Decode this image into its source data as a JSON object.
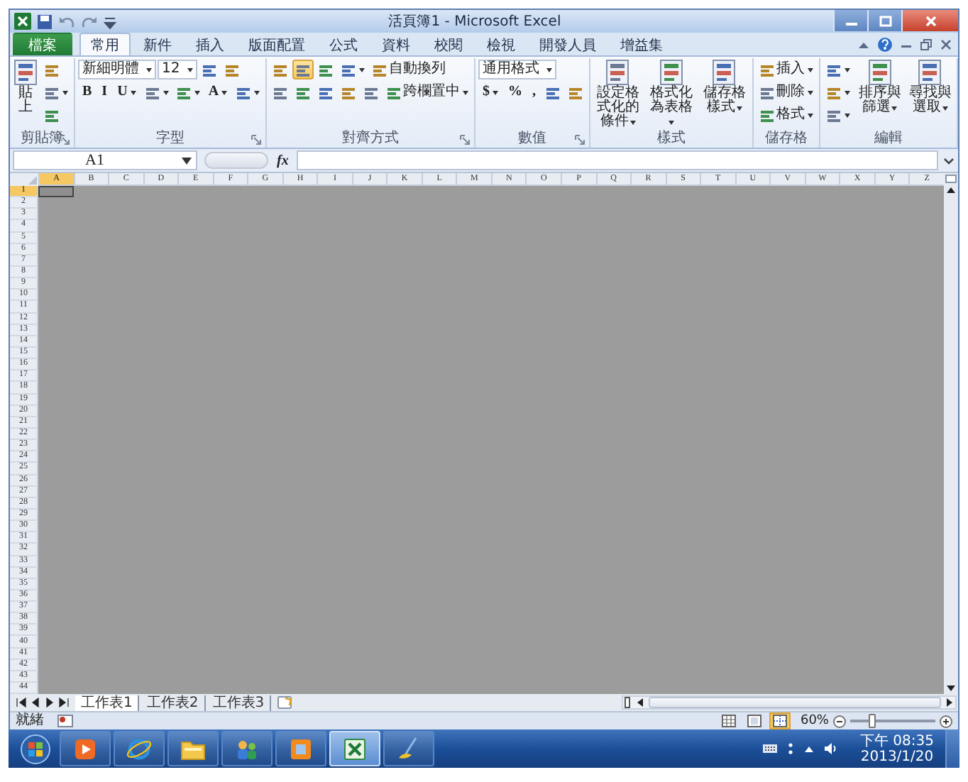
{
  "window": {
    "title": "活頁簿1 - Microsoft Excel"
  },
  "ribbon_tabs": [
    {
      "label": "檔案",
      "kind": "file",
      "selected": false
    },
    {
      "label": "常用",
      "kind": "tab",
      "selected": true
    },
    {
      "label": "新件",
      "kind": "tab",
      "selected": false
    },
    {
      "label": "插入",
      "kind": "tab",
      "selected": false
    },
    {
      "label": "版面配置",
      "kind": "tab",
      "selected": false
    },
    {
      "label": "公式",
      "kind": "tab",
      "selected": false
    },
    {
      "label": "資料",
      "kind": "tab",
      "selected": false
    },
    {
      "label": "校閱",
      "kind": "tab",
      "selected": false
    },
    {
      "label": "檢視",
      "kind": "tab",
      "selected": false
    },
    {
      "label": "開發人員",
      "kind": "tab",
      "selected": false
    },
    {
      "label": "增益集",
      "kind": "tab",
      "selected": false
    }
  ],
  "ribbon_groups": [
    {
      "label": "剪貼簿",
      "launcher": true,
      "parts": [
        {
          "kind": "large",
          "label": "貼上"
        },
        {
          "kind": "stack",
          "lines": [
            [
              {
                "kind": "icon"
              }
            ],
            [
              {
                "kind": "split"
              }
            ],
            [
              {
                "kind": "icon"
              }
            ]
          ]
        }
      ]
    },
    {
      "label": "字型",
      "launcher": true,
      "parts": [
        {
          "kind": "stack",
          "lines": [
            [
              {
                "kind": "dropdown",
                "value": "新細明體"
              },
              {
                "kind": "dropdown",
                "value": "12"
              },
              {
                "kind": "icon"
              },
              {
                "kind": "icon"
              }
            ],
            [
              {
                "kind": "glyph",
                "label": "B"
              },
              {
                "kind": "glyph",
                "label": "I"
              },
              {
                "kind": "glyph-split",
                "label": "U"
              },
              {
                "kind": "split"
              },
              {
                "kind": "split"
              },
              {
                "kind": "glyph-split",
                "label": "A"
              },
              {
                "kind": "split"
              }
            ]
          ]
        }
      ]
    },
    {
      "label": "對齊方式",
      "launcher": true,
      "parts": [
        {
          "kind": "stack",
          "lines": [
            [
              {
                "kind": "icon",
                "on": false
              },
              {
                "kind": "icon",
                "on": true
              },
              {
                "kind": "icon",
                "on": false
              },
              {
                "kind": "split",
                "on": false
              },
              {
                "kind": "small",
                "label": "自動換列",
                "on": false
              }
            ],
            [
              {
                "kind": "icon",
                "on": false
              },
              {
                "kind": "icon",
                "on": false
              },
              {
                "kind": "icon",
                "on": false
              },
              {
                "kind": "icon",
                "on": false
              },
              {
                "kind": "icon",
                "on": false
              },
              {
                "kind": "small-split",
                "label": "跨欄置中",
                "on": false
              }
            ]
          ]
        }
      ]
    },
    {
      "label": "數值",
      "launcher": true,
      "parts": [
        {
          "kind": "stack",
          "lines": [
            [
              {
                "kind": "dropdown",
                "value": "通用格式"
              }
            ],
            [
              {
                "kind": "glyph-split",
                "label": "$"
              },
              {
                "kind": "glyph",
                "label": "%"
              },
              {
                "kind": "glyph",
                "label": ","
              },
              {
                "kind": "icon"
              },
              {
                "kind": "icon"
              }
            ]
          ]
        }
      ]
    },
    {
      "label": "樣式",
      "launcher": false,
      "parts": [
        {
          "kind": "large-split",
          "label": "設定格式化的條件"
        },
        {
          "kind": "large-split",
          "label": "格式化為表格"
        },
        {
          "kind": "large-split",
          "label": "儲存格樣式"
        }
      ]
    },
    {
      "label": "儲存格",
      "launcher": false,
      "parts": [
        {
          "kind": "stack",
          "lines": [
            [
              {
                "kind": "small-split",
                "label": "插入"
              }
            ],
            [
              {
                "kind": "small-split",
                "label": "刪除"
              }
            ],
            [
              {
                "kind": "small-split",
                "label": "格式"
              }
            ]
          ]
        }
      ]
    },
    {
      "label": "編輯",
      "launcher": false,
      "parts": [
        {
          "kind": "stack",
          "lines": [
            [
              {
                "kind": "split"
              }
            ],
            [
              {
                "kind": "split"
              }
            ],
            [
              {
                "kind": "split"
              }
            ]
          ]
        },
        {
          "kind": "large-split",
          "label": "排序與篩選"
        },
        {
          "kind": "large-split",
          "label": "尋找與選取"
        }
      ]
    }
  ],
  "formula_bar": {
    "name_box": "A1",
    "function_label": "fx"
  },
  "columns": [
    {
      "label": "A",
      "selected": true
    },
    {
      "label": "B",
      "selected": false
    },
    {
      "label": "C",
      "selected": false
    },
    {
      "label": "D",
      "selected": false
    },
    {
      "label": "E",
      "selected": false
    },
    {
      "label": "F",
      "selected": false
    },
    {
      "label": "G",
      "selected": false
    },
    {
      "label": "H",
      "selected": false
    },
    {
      "label": "I",
      "selected": false
    },
    {
      "label": "J",
      "selected": false
    },
    {
      "label": "K",
      "selected": false
    },
    {
      "label": "L",
      "selected": false
    },
    {
      "label": "M",
      "selected": false
    },
    {
      "label": "N",
      "selected": false
    },
    {
      "label": "O",
      "selected": false
    },
    {
      "label": "P",
      "selected": false
    },
    {
      "label": "Q",
      "selected": false
    },
    {
      "label": "R",
      "selected": false
    },
    {
      "label": "S",
      "selected": false
    },
    {
      "label": "T",
      "selected": false
    },
    {
      "label": "U",
      "selected": false
    },
    {
      "label": "V",
      "selected": false
    },
    {
      "label": "W",
      "selected": false
    },
    {
      "label": "X",
      "selected": false
    },
    {
      "label": "Y",
      "selected": false
    },
    {
      "label": "Z",
      "selected": false
    }
  ],
  "rows": [
    {
      "label": "1",
      "selected": true
    },
    {
      "label": "2",
      "selected": false
    },
    {
      "label": "3",
      "selected": false
    },
    {
      "label": "4",
      "selected": false
    },
    {
      "label": "5",
      "selected": false
    },
    {
      "label": "6",
      "selected": false
    },
    {
      "label": "7",
      "selected": false
    },
    {
      "label": "8",
      "selected": false
    },
    {
      "label": "9",
      "selected": false
    },
    {
      "label": "10",
      "selected": false
    },
    {
      "label": "11",
      "selected": false
    },
    {
      "label": "12",
      "selected": false
    },
    {
      "label": "13",
      "selected": false
    },
    {
      "label": "14",
      "selected": false
    },
    {
      "label": "15",
      "selected": false
    },
    {
      "label": "16",
      "selected": false
    },
    {
      "label": "17",
      "selected": false
    },
    {
      "label": "18",
      "selected": false
    },
    {
      "label": "19",
      "selected": false
    },
    {
      "label": "20",
      "selected": false
    },
    {
      "label": "21",
      "selected": false
    },
    {
      "label": "22",
      "selected": false
    },
    {
      "label": "23",
      "selected": false
    },
    {
      "label": "24",
      "selected": false
    },
    {
      "label": "25",
      "selected": false
    },
    {
      "label": "26",
      "selected": false
    },
    {
      "label": "27",
      "selected": false
    },
    {
      "label": "28",
      "selected": false
    },
    {
      "label": "29",
      "selected": false
    },
    {
      "label": "30",
      "selected": false
    },
    {
      "label": "31",
      "selected": false
    },
    {
      "label": "32",
      "selected": false
    },
    {
      "label": "33",
      "selected": false
    },
    {
      "label": "34",
      "selected": false
    },
    {
      "label": "35",
      "selected": false
    },
    {
      "label": "36",
      "selected": false
    },
    {
      "label": "37",
      "selected": false
    },
    {
      "label": "38",
      "selected": false
    },
    {
      "label": "39",
      "selected": false
    },
    {
      "label": "40",
      "selected": false
    },
    {
      "label": "41",
      "selected": false
    },
    {
      "label": "42",
      "selected": false
    },
    {
      "label": "43",
      "selected": false
    },
    {
      "label": "44",
      "selected": false
    }
  ],
  "sheet_tabs": [
    {
      "label": "工作表1",
      "selected": true
    },
    {
      "label": "工作表2",
      "selected": false
    },
    {
      "label": "工作表3",
      "selected": false
    }
  ],
  "status_bar": {
    "status": "就緒",
    "views": [
      {
        "selected": false
      },
      {
        "selected": false
      },
      {
        "selected": true
      }
    ],
    "zoom": {
      "reading": "60%",
      "level": 0.25
    }
  },
  "taskbar": {
    "items": [
      {
        "kind": "player",
        "selected": false
      },
      {
        "kind": "browser",
        "selected": false
      },
      {
        "kind": "folder",
        "selected": false
      },
      {
        "kind": "people",
        "selected": false
      },
      {
        "kind": "frame",
        "selected": false
      },
      {
        "kind": "spreadsheet",
        "selected": true
      },
      {
        "kind": "paint",
        "selected": false
      }
    ],
    "time": "下午 08:35",
    "date": "2013/1/20"
  }
}
